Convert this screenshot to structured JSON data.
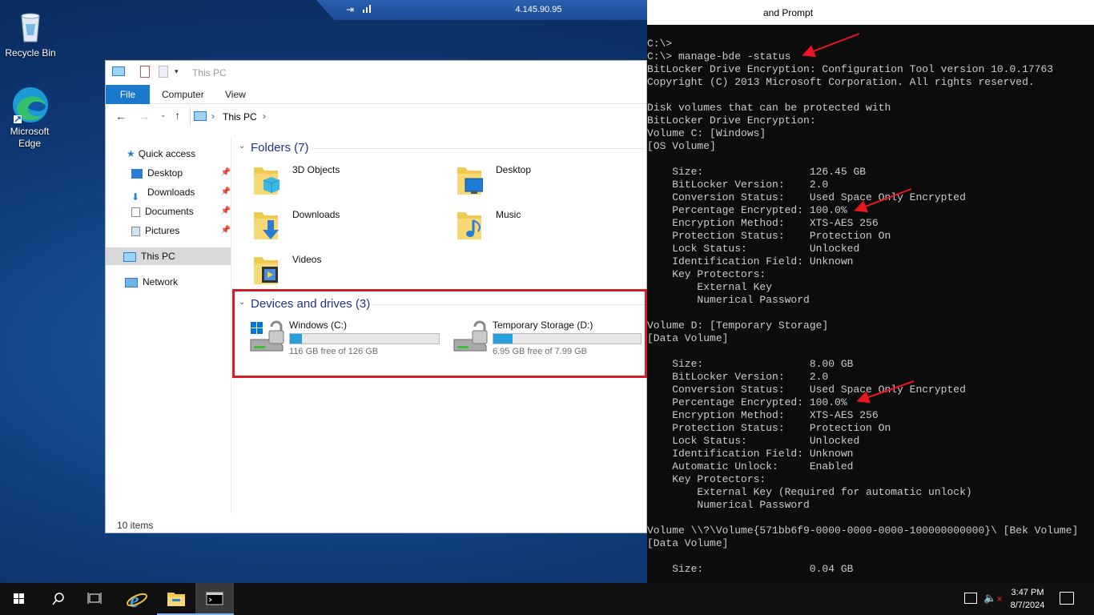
{
  "desktop": {
    "icons": [
      {
        "label": "Recycle Bin"
      },
      {
        "label": "Microsoft Edge"
      }
    ]
  },
  "rdp_bar": {
    "title": "4.145.90.95"
  },
  "cmd": {
    "title_partial": "and Prompt",
    "lines": [
      "C:\\>",
      "C:\\> manage-bde -status",
      "BitLocker Drive Encryption: Configuration Tool version 10.0.17763",
      "Copyright (C) 2013 Microsoft Corporation. All rights reserved.",
      "",
      "Disk volumes that can be protected with",
      "BitLocker Drive Encryption:",
      "Volume C: [Windows]",
      "[OS Volume]",
      "",
      "    Size:                 126.45 GB",
      "    BitLocker Version:    2.0",
      "    Conversion Status:    Used Space Only Encrypted",
      "    Percentage Encrypted: 100.0%",
      "    Encryption Method:    XTS-AES 256",
      "    Protection Status:    Protection On",
      "    Lock Status:          Unlocked",
      "    Identification Field: Unknown",
      "    Key Protectors:",
      "        External Key",
      "        Numerical Password",
      "",
      "Volume D: [Temporary Storage]",
      "[Data Volume]",
      "",
      "    Size:                 8.00 GB",
      "    BitLocker Version:    2.0",
      "    Conversion Status:    Used Space Only Encrypted",
      "    Percentage Encrypted: 100.0%",
      "    Encryption Method:    XTS-AES 256",
      "    Protection Status:    Protection On",
      "    Lock Status:          Unlocked",
      "    Identification Field: Unknown",
      "    Automatic Unlock:     Enabled",
      "    Key Protectors:",
      "        External Key (Required for automatic unlock)",
      "        Numerical Password",
      "",
      "Volume \\\\?\\Volume{571bb6f9-0000-0000-0000-100000000000}\\ [Bek Volume]",
      "[Data Volume]",
      "",
      "    Size:                 0.04 GB"
    ]
  },
  "explorer": {
    "title": "This PC",
    "ribbon_tabs": [
      "File",
      "Computer",
      "View"
    ],
    "address": "This PC",
    "nav": {
      "quick_access": "Quick access",
      "items": [
        "Desktop",
        "Downloads",
        "Documents",
        "Pictures"
      ],
      "this_pc": "This PC",
      "network": "Network"
    },
    "folders_header": "Folders (7)",
    "folders": [
      "3D Objects",
      "Desktop",
      "Downloads",
      "Music",
      "Videos"
    ],
    "devices_header": "Devices and drives (3)",
    "drives": [
      {
        "name": "Windows (C:)",
        "free": "116 GB free of 126 GB",
        "used_fraction": 0.08
      },
      {
        "name": "Temporary Storage (D:)",
        "free": "6.95 GB free of 7.99 GB",
        "used_fraction": 0.13
      }
    ],
    "status": "10 items"
  },
  "taskbar": {
    "time": "3:47 PM",
    "date": "8/7/2024"
  },
  "colors": {
    "accent": "#1979ca",
    "highlight_box": "#d32028",
    "drive_fill": "#26a0da"
  }
}
